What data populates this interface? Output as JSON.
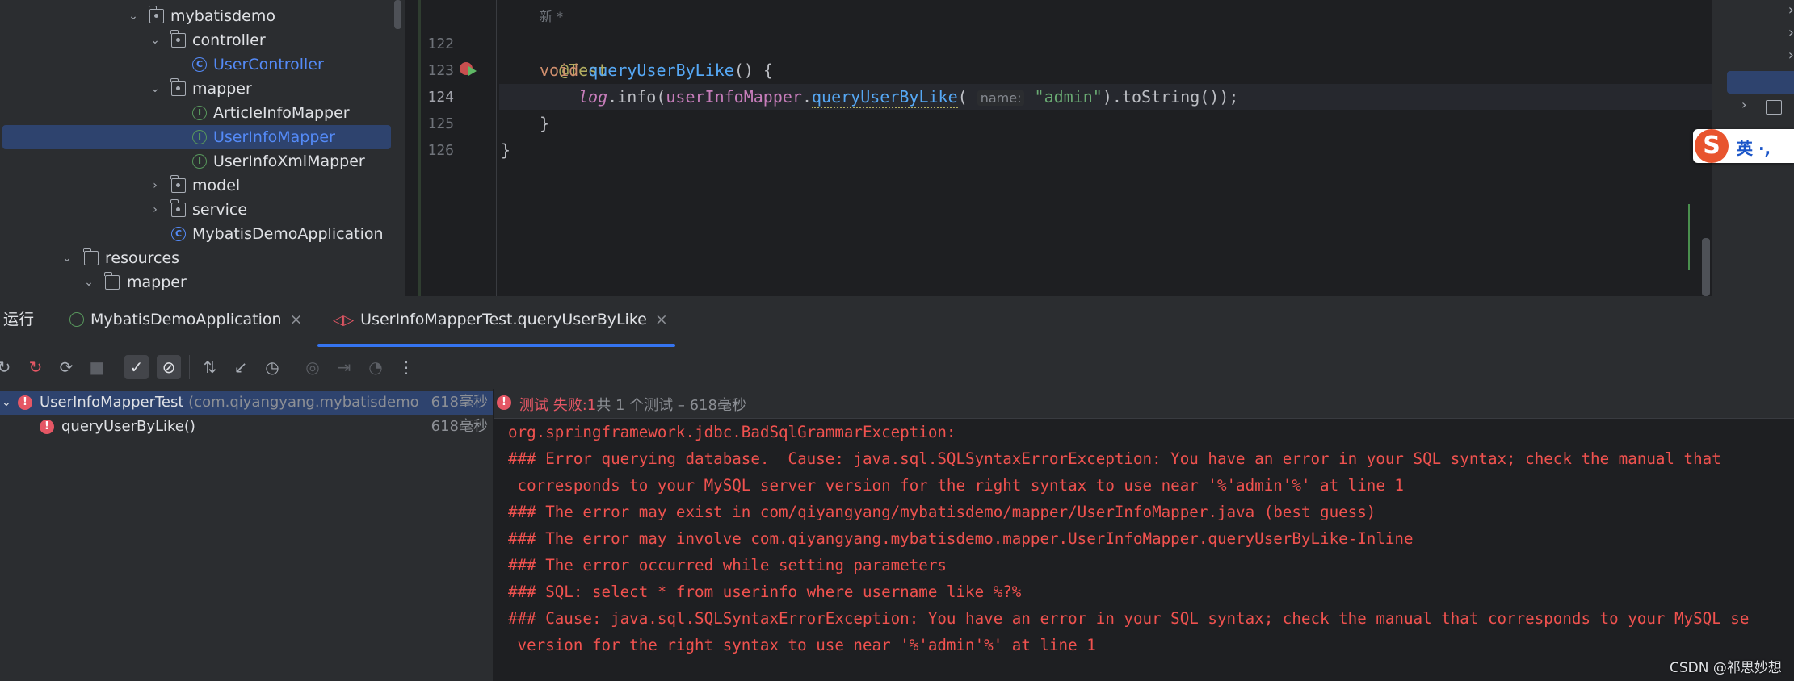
{
  "project_tree": {
    "items": [
      {
        "label": "mybatisdemo",
        "type": "package",
        "expanded": true
      },
      {
        "label": "controller",
        "type": "package",
        "expanded": true
      },
      {
        "label": "UserController",
        "type": "class"
      },
      {
        "label": "mapper",
        "type": "package",
        "expanded": true
      },
      {
        "label": "ArticleInfoMapper",
        "type": "interface"
      },
      {
        "label": "UserInfoMapper",
        "type": "interface",
        "selected": true
      },
      {
        "label": "UserInfoXmlMapper",
        "type": "interface"
      },
      {
        "label": "model",
        "type": "package",
        "expanded": false
      },
      {
        "label": "service",
        "type": "package",
        "expanded": false
      },
      {
        "label": "MybatisDemoApplication",
        "type": "spring-boot-class"
      },
      {
        "label": "resources",
        "type": "folder",
        "expanded": true
      },
      {
        "label": "mapper",
        "type": "folder",
        "expanded": true
      }
    ]
  },
  "editor": {
    "new_tag": "新 *",
    "lines": [
      {
        "num": "122",
        "annotation": "@Test"
      },
      {
        "num": "123",
        "kw": "void",
        "method": "queryUserByLike",
        "rest": "() {"
      },
      {
        "num": "124",
        "log": "log",
        "dot_info": ".info(",
        "field": "userInfoMapper",
        "dot": ".",
        "call": "queryUserByLike",
        "paren": "(",
        "param_hint": "name:",
        "arg": "\"admin\"",
        "tail": ").toString());",
        "semicolon": ";"
      },
      {
        "num": "125",
        "text": "}"
      },
      {
        "num": "126",
        "text": "}"
      }
    ]
  },
  "ime": {
    "text": "英 ·,"
  },
  "run_window": {
    "title": "运行",
    "tabs": [
      {
        "label": "MybatisDemoApplication",
        "close": "×"
      },
      {
        "label": "UserInfoMapperTest.queryUserByLike",
        "close": "×",
        "active": true
      }
    ],
    "tests": [
      {
        "name": "UserInfoMapperTest",
        "pkg": "(com.qiyangyang.mybatisdemo",
        "time": "618毫秒"
      },
      {
        "name": "queryUserByLike()",
        "time": "618毫秒"
      }
    ],
    "status": {
      "label": "测试 失败:",
      "count": "1",
      "summary": "共 1 个测试 – 618毫秒"
    },
    "console_lines": [
      "org.springframework.jdbc.BadSqlGrammarException: ",
      "### Error querying database.  Cause: java.sql.SQLSyntaxErrorException: You have an error in your SQL syntax; check the manual that",
      " corresponds to your MySQL server version for the right syntax to use near '%'admin'%' at line 1",
      "### The error may exist in com/qiyangyang/mybatisdemo/mapper/UserInfoMapper.java (best guess)",
      "### The error may involve com.qiyangyang.mybatisdemo.mapper.UserInfoMapper.queryUserByLike-Inline",
      "### The error occurred while setting parameters",
      "### SQL: select * from userinfo where username like %?%",
      "### Cause: java.sql.SQLSyntaxErrorException: You have an error in your SQL syntax; check the manual that corresponds to your MySQL se",
      " version for the right syntax to use near '%'admin'%' at line 1"
    ]
  },
  "watermark": "CSDN @祁思妙想",
  "colors": {
    "accent": "#3574f0",
    "error": "#e55765",
    "selection": "#2e436e"
  }
}
